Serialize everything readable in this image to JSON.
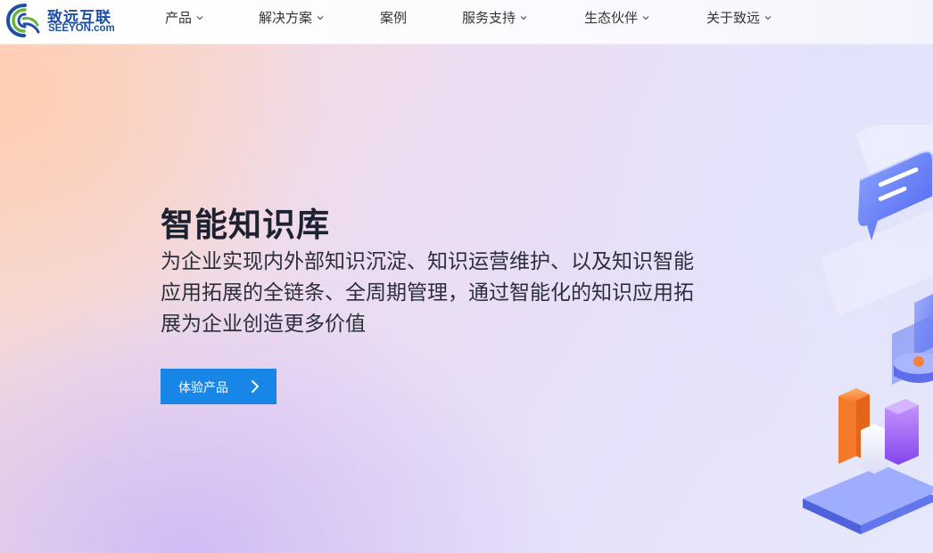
{
  "brand": {
    "name_cn": "致远互联",
    "name_en": "SEEYON.com",
    "logo_icon": "seeyon-swirl-logo",
    "colors": {
      "primary": "#1e4fa6",
      "green": "#6cb33e"
    }
  },
  "nav": {
    "items": [
      {
        "label": "产品",
        "has_dropdown": true
      },
      {
        "label": "解决方案",
        "has_dropdown": true
      },
      {
        "label": "案例",
        "has_dropdown": false
      },
      {
        "label": "服务支持",
        "has_dropdown": true
      },
      {
        "label": "生态伙伴",
        "has_dropdown": true
      },
      {
        "label": "关于致远",
        "has_dropdown": true
      }
    ],
    "dropdown_icon": "chevron-down-icon"
  },
  "hero": {
    "title": "智能知识库",
    "description": "为企业实现内外部知识沉淀、知识运营维护、以及知识智能应用拓展的全链条、全周期管理，通过智能化的知识应用拓展为企业创造更多价值",
    "cta": {
      "label": "体验产品",
      "icon": "chevron-right-icon",
      "color": "#1786e6"
    },
    "illustration": "isometric-knowledge-base-illustration"
  }
}
